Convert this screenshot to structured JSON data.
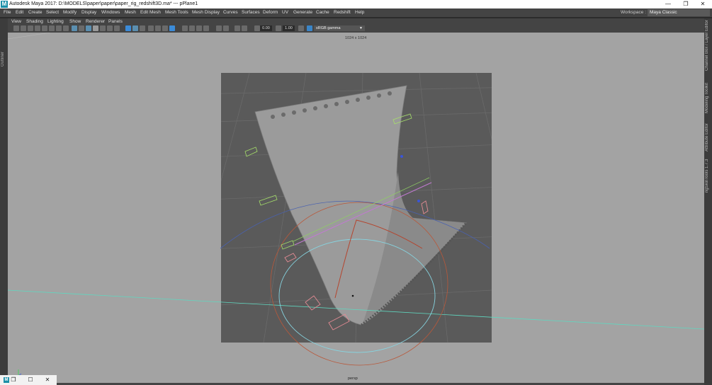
{
  "window": {
    "app_icon": "M",
    "title": "Autodesk Maya 2017: D:\\MODELS\\paper\\paper\\paper_rig_redshift3D.ma*   ---   pPlane1",
    "minimize": "—",
    "restore": "❐",
    "close": "✕"
  },
  "menu": {
    "items": [
      "File",
      "Edit",
      "Create",
      "Select",
      "Modify",
      "Display",
      "Windows",
      "Mesh",
      "Edit Mesh",
      "Mesh Tools",
      "Mesh Display",
      "Curves",
      "Surfaces",
      "Deform",
      "UV",
      "Generate",
      "Cache",
      "Redshift",
      "Help"
    ],
    "workspace_label": "Workspace :",
    "workspace_value": "Maya Classic"
  },
  "side": {
    "left_tab": "Outliner",
    "right_tabs": [
      "Channel Box / Layer Editor",
      "Modeling Toolkit",
      "Attribute Editor",
      "ngSkinTools 1.7.3"
    ]
  },
  "panel_menu": [
    "View",
    "Shading",
    "Lighting",
    "Show",
    "Renderer",
    "Panels"
  ],
  "toolbar": {
    "field_1": "0.00",
    "field_2": "1.00",
    "color_space": "sRGB gamma"
  },
  "viewport": {
    "resolution_label": "1024 x 1024",
    "camera_label": "persp"
  },
  "taskbar": {
    "maya_icon": "M",
    "restore_icon": "❐",
    "maximize_icon": "☐",
    "close_icon": "✕"
  }
}
